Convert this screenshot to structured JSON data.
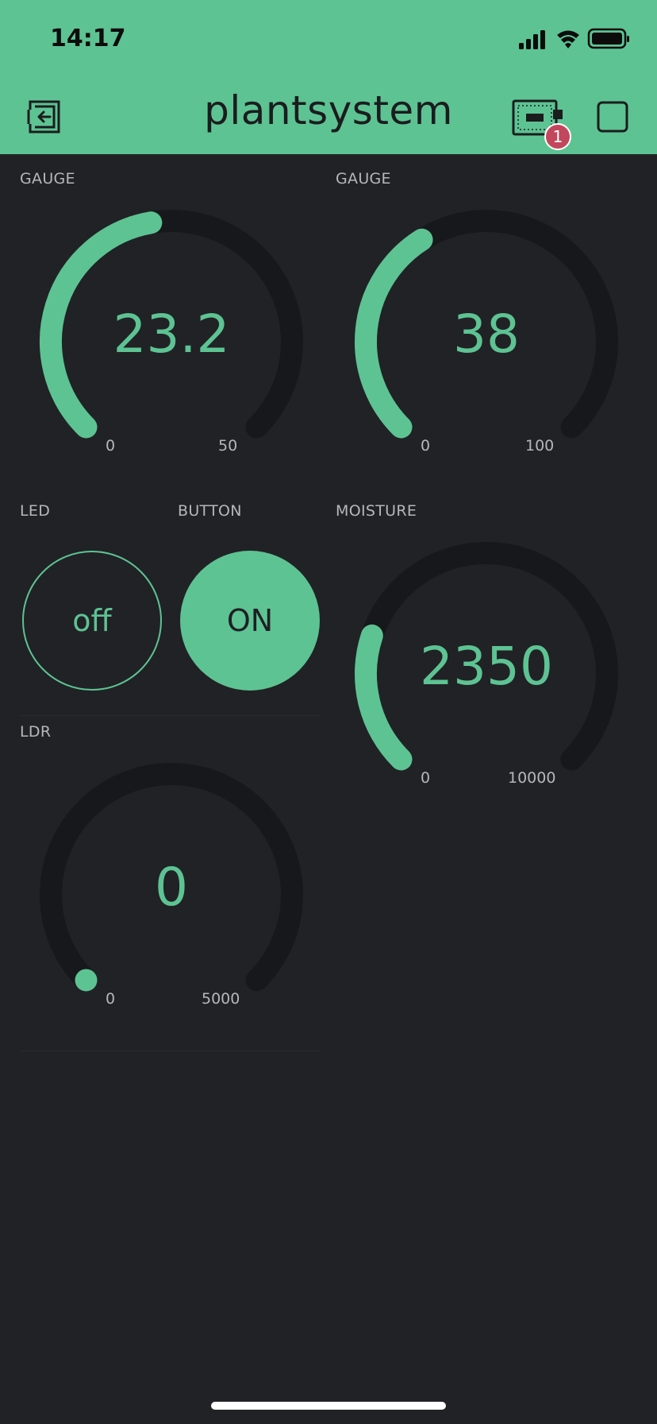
{
  "status_bar": {
    "time": "14:17",
    "icons": [
      "signal-icon",
      "wifi-icon",
      "battery-icon"
    ]
  },
  "header": {
    "title": "plantsystem",
    "left_icon": "exit-icon",
    "device_icon": "device-board-icon",
    "device_badge": "1",
    "right_icon": "stop-square-icon",
    "background": "#5dc393"
  },
  "colors": {
    "accent": "#5dc393",
    "track": "#17181b",
    "background": "#212225",
    "label": "#b6b7ba"
  },
  "widgets": {
    "gauge1": {
      "label": "GAUGE",
      "value": "23.2",
      "min": "0",
      "max": "50",
      "level": 0.464
    },
    "gauge2": {
      "label": "GAUGE",
      "value": "38",
      "min": "0",
      "max": "100",
      "level": 0.38
    },
    "led": {
      "label": "LED",
      "state": "off"
    },
    "button": {
      "label": "BUTTON",
      "state": "ON"
    },
    "moisture": {
      "label": "MOISTURE",
      "value": "2350",
      "min": "0",
      "max": "10000",
      "level": 0.235
    },
    "ldr": {
      "label": "LDR",
      "value": "0",
      "min": "0",
      "max": "5000",
      "level": 0
    }
  }
}
